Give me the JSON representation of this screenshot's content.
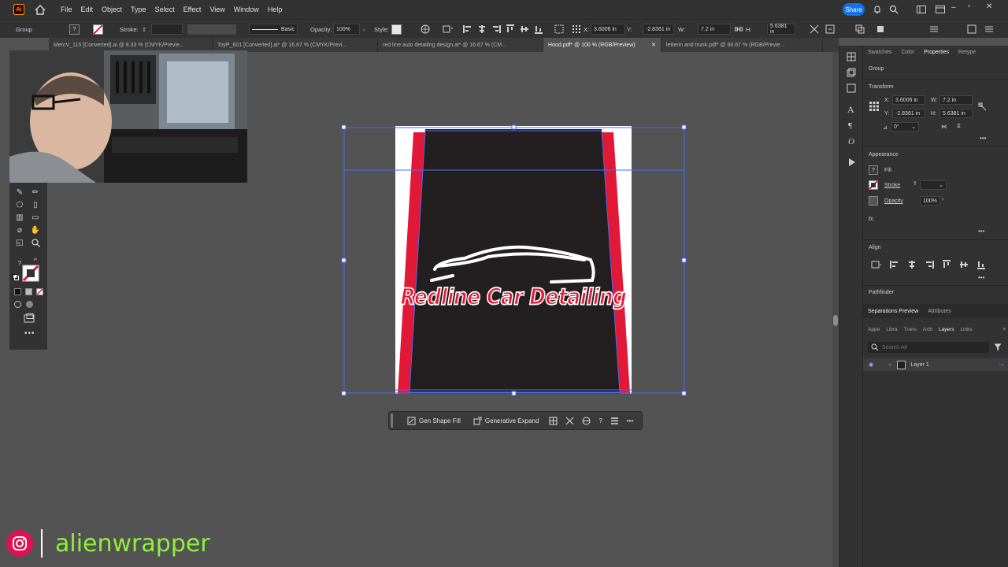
{
  "menubar": {
    "app_logo": "Ai",
    "items": [
      "File",
      "Edit",
      "Object",
      "Type",
      "Select",
      "Effect",
      "View",
      "Window",
      "Help"
    ],
    "share_label": "Share"
  },
  "control_bar": {
    "selection_label": "Group",
    "stroke_label": "Stroke:",
    "brush_label": "Basic",
    "opacity_label": "Opacity:",
    "opacity_value": "100%",
    "style_label": "Style:",
    "x_label": "X:",
    "x_value": "3.6006 in",
    "y_label": "Y:",
    "y_value": "-2.8361 in",
    "w_label": "W:",
    "w_value": "7.2 in",
    "h_label": "H:",
    "h_value": "5.6381 in"
  },
  "doc_tabs": [
    {
      "label": "MercV_115 [Converted].ai @ 8.33 % (CMYK/Previe...",
      "active": false
    },
    {
      "label": "ToyP_601 [Converted].ai* @ 16.67 % (CMYK/Previ...",
      "active": false
    },
    {
      "label": "red line auto detailing design.ai* @ 16.67 % (CM...",
      "active": false
    },
    {
      "label": "Hood.pdf* @ 100 % (RGB/Preview)",
      "active": true
    },
    {
      "label": "letterin and trunk.pdf* @ 66.67 % (RGB/Previe...",
      "active": false
    }
  ],
  "artwork": {
    "logo_text": "Redline Car Detailing",
    "colors": {
      "dark": "#231f20",
      "red": "#e21837",
      "white": "#ffffff",
      "selection": "#4a6cf0"
    }
  },
  "context_bar": {
    "gen_shape_fill": "Gen Shape Fill",
    "generative_expand": "Generative Expand"
  },
  "right_panel": {
    "tabs": [
      "Swatches",
      "Color",
      "Properties",
      "Retype"
    ],
    "active_tab": "Properties",
    "selection_type": "Group",
    "transform_title": "Transform",
    "x_label": "X:",
    "x_value": "3.6006 in",
    "y_label": "Y:",
    "y_value": "-2.8361 in",
    "w_label": "W:",
    "w_value": "7.2 in",
    "h_label": "H:",
    "h_value": "5.6381 in",
    "rotate_value": "0°",
    "appearance_title": "Appearance",
    "fill_label": "Fill",
    "stroke_label": "Stroke",
    "opacity_label": "Opacity",
    "opacity_value": "100%",
    "fx_label": "fx.",
    "align_title": "Align",
    "pathfinder_title": "Pathfinder",
    "sub_tabs1": [
      "Separations Preview",
      "Attributes"
    ],
    "sub_tabs2": [
      "Appe",
      "Libra",
      "Trans",
      "Artb",
      "Layers",
      "Links"
    ],
    "active_sub_tab": "Layers",
    "search_placeholder": "Search All",
    "layer_name": "Layer 1"
  },
  "watermark": {
    "handle": "alienwrapper"
  }
}
